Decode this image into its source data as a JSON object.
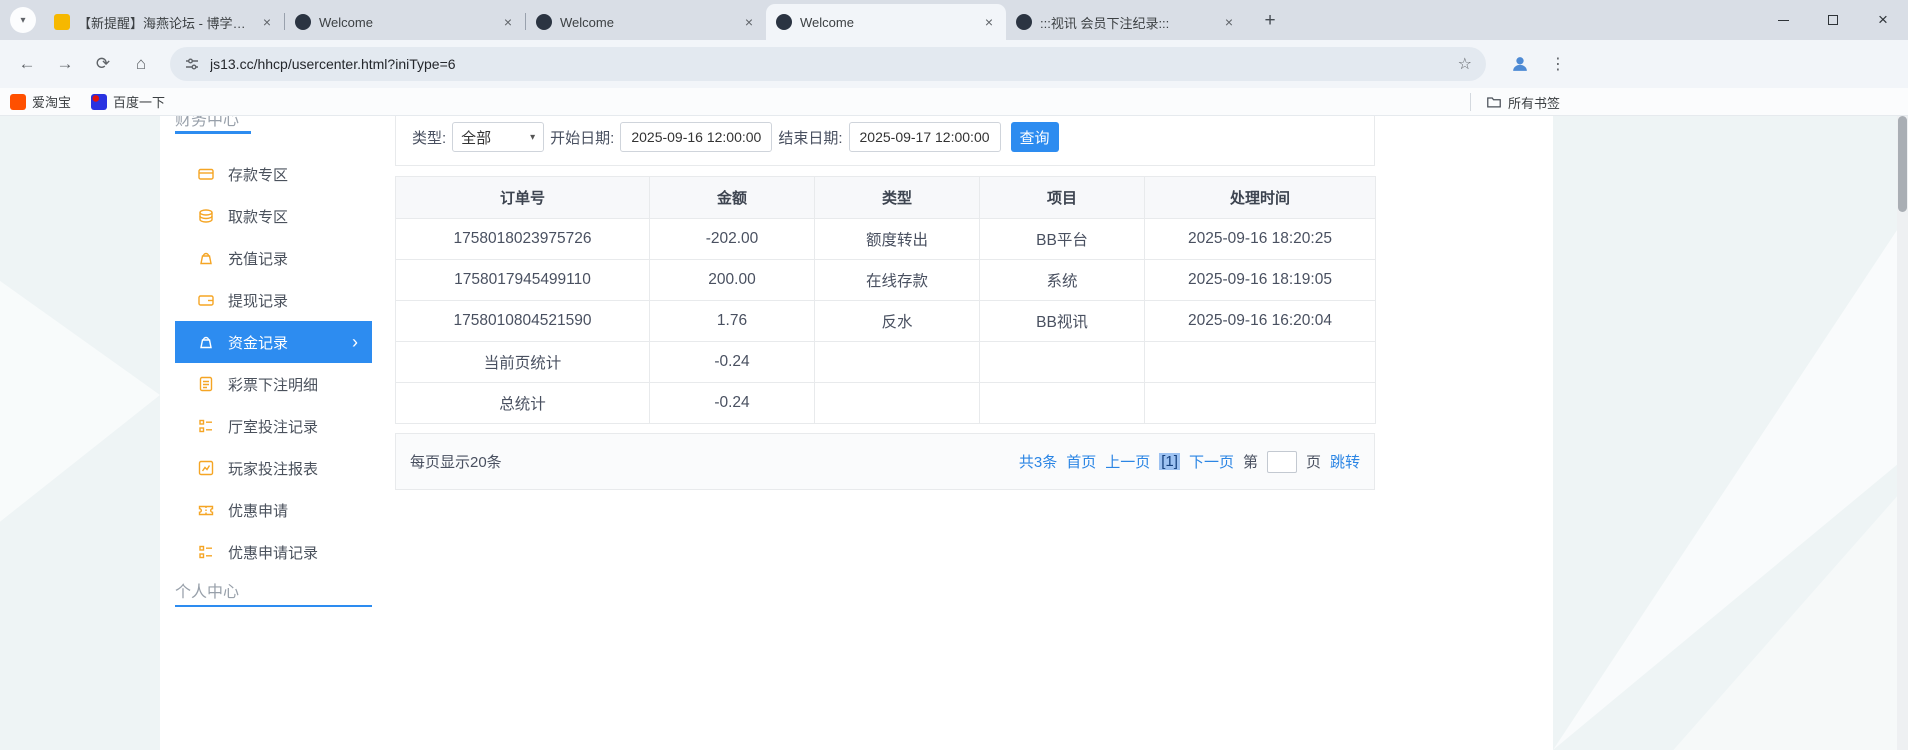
{
  "browser": {
    "tabs": [
      {
        "title": "【新提醒】海燕论坛 - 博学交...",
        "active": false
      },
      {
        "title": "Welcome",
        "active": false
      },
      {
        "title": "Welcome",
        "active": false
      },
      {
        "title": "Welcome",
        "active": true
      },
      {
        "title": ":::视讯 会员下注纪录:::",
        "active": false
      }
    ],
    "toolbar": {
      "url": "js13.cc/hhcp/usercenter.html?iniType=6"
    },
    "bookmarks_bar": {
      "items": [
        {
          "label": "爱淘宝"
        },
        {
          "label": "百度一下"
        }
      ],
      "all_bookmarks": "所有书签"
    }
  },
  "glyphs": {
    "close": "×",
    "plus": "+",
    "back": "←",
    "forward": "→",
    "reload": "⟳",
    "home": "⌂",
    "star": "☆",
    "menu": "⋮",
    "tab_search": "▾",
    "dropdown": "▾",
    "chevron_right": "›"
  },
  "sidebar": {
    "top_section": "财务中心",
    "items": [
      {
        "label": "存款专区"
      },
      {
        "label": "取款专区"
      },
      {
        "label": "充值记录"
      },
      {
        "label": "提现记录"
      },
      {
        "label": "资金记录"
      },
      {
        "label": "彩票下注明细"
      },
      {
        "label": "厅室投注记录"
      },
      {
        "label": "玩家投注报表"
      },
      {
        "label": "优惠申请"
      },
      {
        "label": "优惠申请记录"
      }
    ],
    "active_index": 4,
    "bottom_section": "个人中心"
  },
  "filters": {
    "type_label": "类型:",
    "type_value": "全部",
    "start_label": "开始日期:",
    "start_value": "2025-09-16 12:00:00",
    "end_label": "结束日期:",
    "end_value": "2025-09-17 12:00:00",
    "search_button": "查询"
  },
  "table": {
    "headers": [
      "订单号",
      "金额",
      "类型",
      "项目",
      "处理时间"
    ],
    "rows": [
      [
        "1758018023975726",
        "-202.00",
        "额度转出",
        "BB平台",
        "2025-09-16 18:20:25"
      ],
      [
        "1758017945499110",
        "200.00",
        "在线存款",
        "系统",
        "2025-09-16 18:19:05"
      ],
      [
        "1758010804521590",
        "1.76",
        "反水",
        "BB视讯",
        "2025-09-16 16:20:04"
      ],
      [
        "当前页统计",
        "-0.24",
        "",
        "",
        ""
      ],
      [
        "总统计",
        "-0.24",
        "",
        "",
        ""
      ]
    ]
  },
  "pagination": {
    "per_page": "每页显示20条",
    "total": "共3条",
    "first": "首页",
    "prev": "上一页",
    "current": "[1]",
    "next": "下一页",
    "jump_pre": "第",
    "jump_post": "页",
    "jump": "跳转"
  },
  "colors": {
    "accent_blue": "#2d8cf0",
    "link_blue": "#2b85e4",
    "icon_orange": "#f5a524",
    "current_page_highlight": "#9dc2f2",
    "tabbar_bg": "#d9dee6"
  }
}
